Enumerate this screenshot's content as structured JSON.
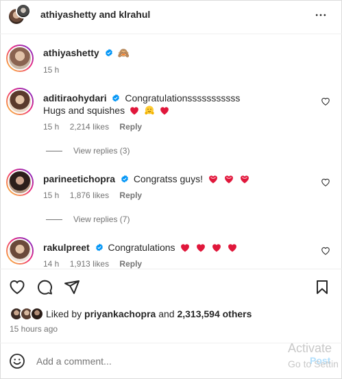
{
  "header": {
    "title": "athiyashetty and klrahul",
    "more_icon": "more-horizontal-icon"
  },
  "caption": {
    "username": "athiyashetty",
    "emoji": "🙈",
    "time": "15 h"
  },
  "comments": [
    {
      "username": "aditiraohydari",
      "text": "Congratulationsssssssssss",
      "text2": "Hugs and squishes",
      "time": "15 h",
      "likes": "2,214 likes",
      "reply": "Reply",
      "view_replies": "View replies (3)"
    },
    {
      "username": "parineetichopra",
      "text": "Congratss guys!",
      "time": "15 h",
      "likes": "1,876 likes",
      "reply": "Reply",
      "view_replies": "View replies (7)"
    },
    {
      "username": "rakulpreet",
      "text": "Congratulations",
      "time": "14 h",
      "likes": "1,913 likes",
      "reply": "Reply"
    }
  ],
  "likes": {
    "prefix": "Liked by",
    "user": "priyankachopra",
    "middle": "and",
    "others": "2,313,594 others"
  },
  "post_time": "15 hours ago",
  "comment_box": {
    "placeholder": "Add a comment...",
    "post_label": "Post"
  },
  "watermark": {
    "line1": "Activate",
    "line2": "Go to Settin"
  },
  "colors": {
    "verified": "#0095f6",
    "heart": "#ed4956",
    "text": "#262626",
    "muted": "#737373"
  }
}
